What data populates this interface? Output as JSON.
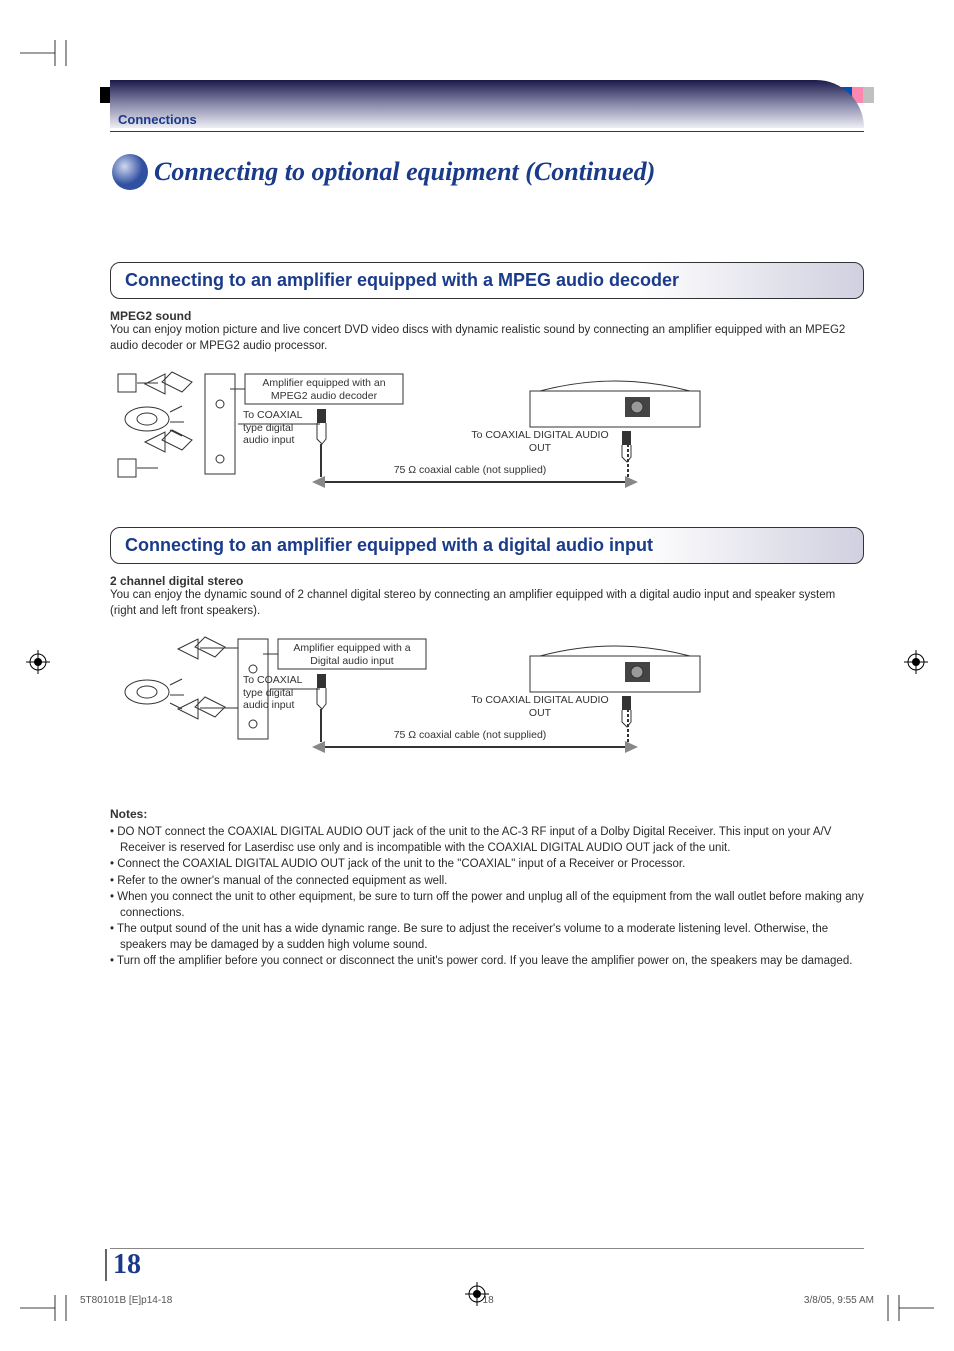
{
  "registration_marks": {
    "color_bars_left": [
      "#000",
      "#000",
      "#000",
      "#000",
      "#000",
      "#b0b0b0",
      "#d0d0d0",
      "#e8e8e8",
      "#f4f4f4"
    ],
    "color_bars_right": [
      "#ffff00",
      "#ff00ff",
      "#00ffff",
      "#888888",
      "#c00020",
      "#00a030",
      "#0050c0",
      "#ff88b0",
      "#c0c0c0"
    ]
  },
  "header": {
    "section_label": "Connections",
    "title": "Connecting to optional equipment (Continued)"
  },
  "section1": {
    "heading": "Connecting to an amplifier equipped with a MPEG audio decoder",
    "subhead": "MPEG2 sound",
    "body": "You can enjoy motion picture and live concert DVD video discs with dynamic realistic sound by connecting an amplifier equipped with an MPEG2 audio decoder or MPEG2 audio processor.",
    "diagram": {
      "amp_label": "Amplifier equipped with an MPEG2 audio decoder",
      "to_coaxial_input": "To COAXIAL type digital audio input",
      "to_coaxial_out": "To COAXIAL DIGITAL AUDIO OUT",
      "cable_label": "75 Ω coaxial cable (not supplied)"
    }
  },
  "section2": {
    "heading": "Connecting to an amplifier equipped with a digital audio input",
    "subhead": "2 channel digital stereo",
    "body": "You can enjoy the dynamic sound of 2 channel digital stereo by connecting an amplifier equipped with a digital audio input and speaker system (right and left front speakers).",
    "diagram": {
      "amp_label": "Amplifier equipped with a Digital audio input",
      "to_coaxial_input": "To COAXIAL type digital audio input",
      "to_coaxial_out": "To COAXIAL DIGITAL AUDIO OUT",
      "cable_label": "75 Ω coaxial cable (not supplied)"
    }
  },
  "notes": {
    "heading": "Notes:",
    "items": [
      "• DO NOT connect the COAXIAL DIGITAL AUDIO OUT jack of the unit to the AC-3 RF input of a Dolby Digital Receiver. This input on your A/V Receiver is reserved for Laserdisc use only and is incompatible with the COAXIAL DIGITAL AUDIO OUT jack of the unit.",
      "• Connect the COAXIAL DIGITAL AUDIO OUT jack of the unit to the \"COAXIAL\" input of a Receiver or Processor.",
      "• Refer to the owner's manual of the connected equipment as well.",
      "• When you connect the unit to other equipment, be sure to turn off the power and unplug all of the equipment from the wall outlet before making any connections.",
      "• The output sound of the unit has a wide dynamic range. Be sure to adjust the receiver's volume to a moderate listening level. Otherwise, the speakers may be damaged by a sudden high volume sound.",
      "• Turn off the amplifier before you connect or disconnect the unit's power cord. If you leave the amplifier power on, the speakers may be damaged."
    ]
  },
  "footer": {
    "page_number": "18",
    "doc_id": "5T80101B [E]p14-18",
    "page_small": "18",
    "datetime": "3/8/05, 9:55 AM"
  }
}
